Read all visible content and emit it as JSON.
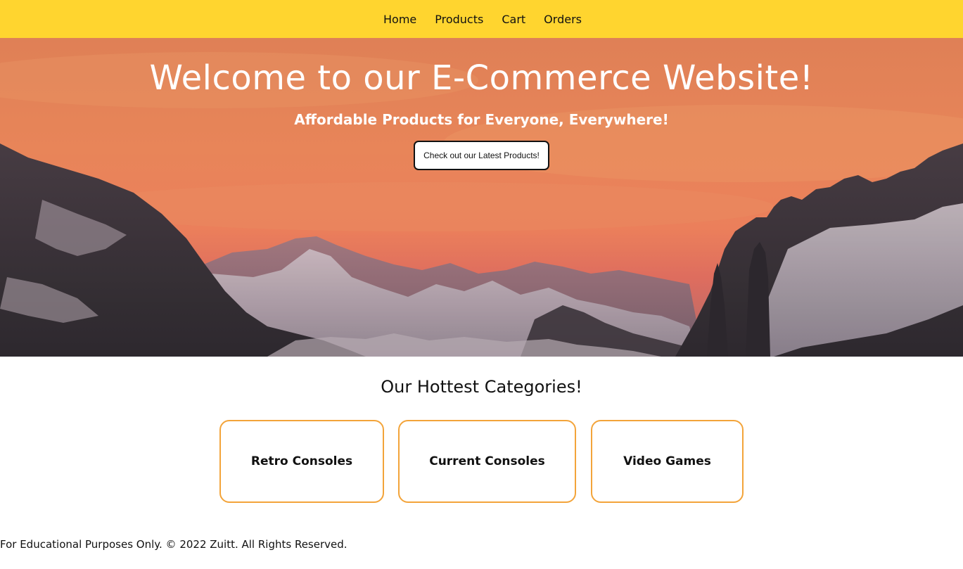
{
  "nav": {
    "items": [
      {
        "label": "Home"
      },
      {
        "label": "Products"
      },
      {
        "label": "Cart"
      },
      {
        "label": "Orders"
      }
    ],
    "background_color": "#ffd52f"
  },
  "hero": {
    "title": "Welcome to our E-Commerce Website!",
    "subtitle": "Affordable Products for Everyone, Everywhere!",
    "button_label": "Check out our Latest Products!",
    "image": "sunset-mountains-landscape"
  },
  "categories": {
    "heading": "Our Hottest Categories!",
    "items": [
      {
        "label": "Retro Consoles"
      },
      {
        "label": "Current Consoles"
      },
      {
        "label": "Video Games"
      }
    ],
    "border_color": "#f3a43a"
  },
  "footer": {
    "text": "For Educational Purposes Only. © 2022 Zuitt. All Rights Reserved."
  }
}
